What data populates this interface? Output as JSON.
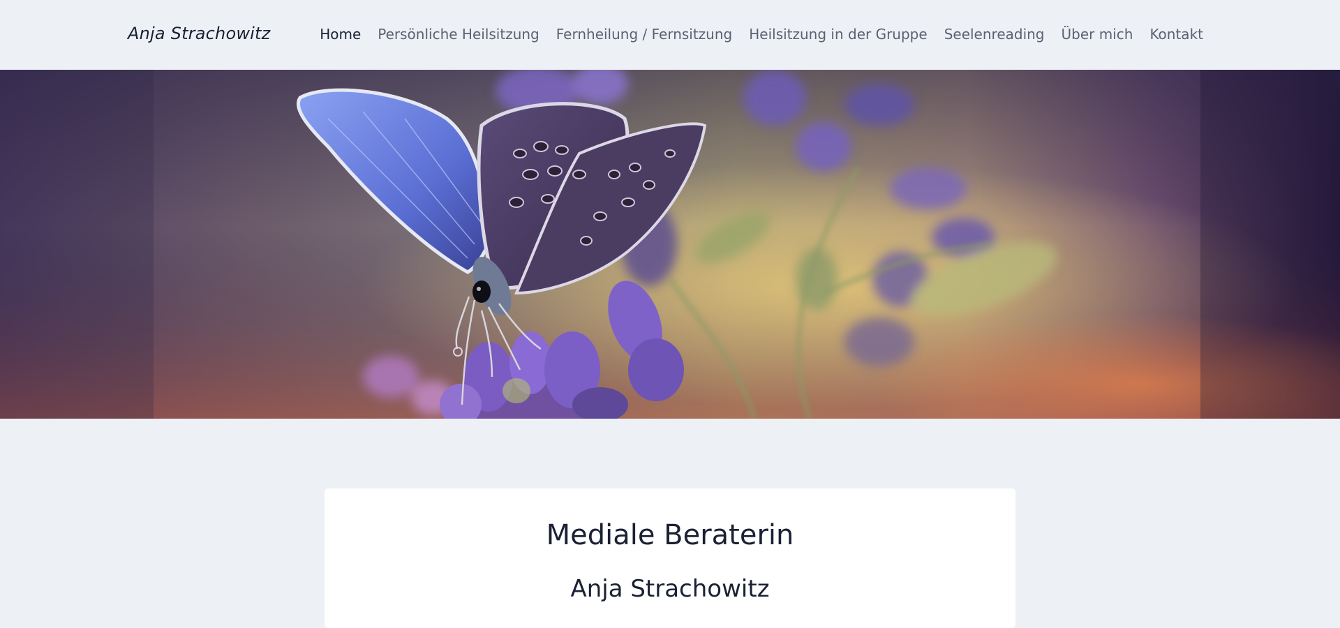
{
  "site": {
    "logo": "Anja Strachowitz"
  },
  "nav": {
    "items": [
      {
        "label": "Home",
        "active": true
      },
      {
        "label": "Persönliche Heilsitzung",
        "active": false
      },
      {
        "label": "Fernheilung / Fernsitzung",
        "active": false
      },
      {
        "label": "Heilsitzung in der Gruppe",
        "active": false
      },
      {
        "label": "Seelenreading",
        "active": false
      },
      {
        "label": "Über mich",
        "active": false
      },
      {
        "label": "Kontakt",
        "active": false
      }
    ]
  },
  "hero": {
    "image": "butterfly-on-purple-flower-image"
  },
  "content": {
    "title": "Mediale Beraterin",
    "subtitle": "Anja Strachowitz"
  },
  "colors": {
    "background": "#edf1f5",
    "text_dark": "#1a2133",
    "nav_text": "#5b6172",
    "card": "#ffffff"
  }
}
